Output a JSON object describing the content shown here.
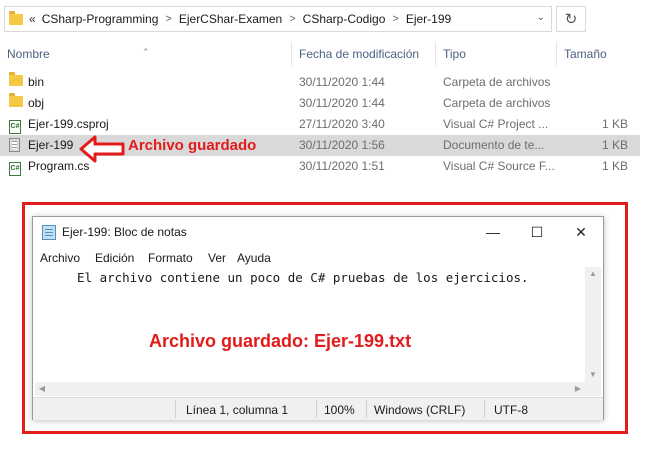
{
  "explorer": {
    "breadcrumb": [
      "CSharp-Programming",
      "EjerCShar-Examen",
      "CSharp-Codigo",
      "Ejer-199"
    ],
    "back_chevron": "«",
    "columns": {
      "name": "Nombre",
      "date": "Fecha de modificación",
      "type": "Tipo",
      "size": "Tamaño"
    },
    "files": [
      {
        "name": "bin",
        "date": "30/11/2020 1:44",
        "type": "Carpeta de archivos",
        "size": "",
        "icon": "folder-icon"
      },
      {
        "name": "obj",
        "date": "30/11/2020 1:44",
        "type": "Carpeta de archivos",
        "size": "",
        "icon": "folder-icon"
      },
      {
        "name": "Ejer-199.csproj",
        "date": "27/11/2020 3:40",
        "type": "Visual C# Project ...",
        "size": "1 KB",
        "icon": "csproj-icon"
      },
      {
        "name": "Ejer-199",
        "date": "30/11/2020 1:56",
        "type": "Documento de te...",
        "size": "1 KB",
        "icon": "text-file-icon"
      },
      {
        "name": "Program.cs",
        "date": "30/11/2020 1:51",
        "type": "Visual C# Source F...",
        "size": "1 KB",
        "icon": "cs-file-icon"
      }
    ],
    "annotation": "Archivo guardado"
  },
  "notepad": {
    "title": "Ejer-199: Bloc de notas",
    "menu": [
      "Archivo",
      "Edición",
      "Formato",
      "Ver",
      "Ayuda"
    ],
    "content": "El archivo contiene un poco de C# pruebas de los ejercicios.",
    "annotation": "Archivo guardado: Ejer-199.txt",
    "status": {
      "position": "Línea 1, columna 1",
      "zoom": "100%",
      "line_ending": "Windows (CRLF)",
      "encoding": "UTF-8"
    }
  },
  "colors": {
    "annotation_red": "#e21b1b",
    "selection": "#d9d9d9",
    "folder": "#f6c944"
  }
}
